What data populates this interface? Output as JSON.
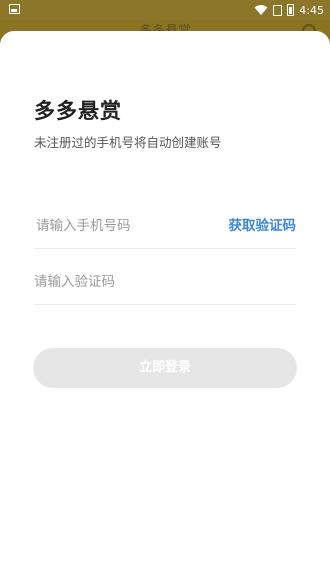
{
  "status_bar": {
    "time": "4:45",
    "icons": [
      "image-icon",
      "wifi-icon",
      "sim-icon",
      "battery-icon"
    ]
  },
  "background": {
    "title": "多多悬赏",
    "icon": "headset-icon"
  },
  "login": {
    "app_title": "多多悬赏",
    "subtitle": "未注册过的手机号将自动创建账号",
    "phone_placeholder": "请输入手机号码",
    "get_code_label": "获取验证码",
    "code_placeholder": "请输入验证码",
    "submit_label": "立即登录"
  },
  "colors": {
    "accent": "#3d87d8",
    "button_disabled": "#e6e6e6",
    "overlay": "#8a7424"
  }
}
